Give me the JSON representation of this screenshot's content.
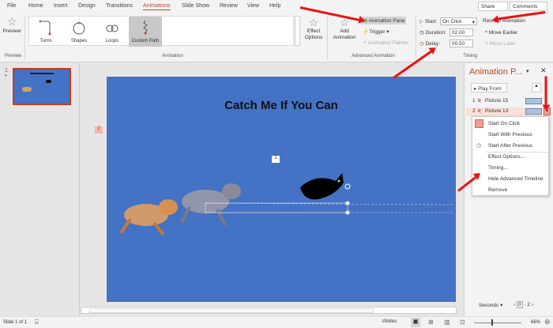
{
  "menu_tabs": [
    "File",
    "Home",
    "Insert",
    "Design",
    "Transitions",
    "Animations",
    "Slide Show",
    "Review",
    "View",
    "Help"
  ],
  "active_tab": "Animations",
  "share_label": "Share",
  "comments_label": "Comments",
  "ribbon": {
    "preview": {
      "label": "Preview",
      "group": "Preview"
    },
    "gallery": [
      {
        "label": "Turns"
      },
      {
        "label": "Shapes"
      },
      {
        "label": "Loops"
      },
      {
        "label": "Custom Path",
        "selected": true
      }
    ],
    "animation_group": "Animation",
    "effect_options": "Effect Options",
    "add_animation": "Add Animation",
    "animation_pane": "Animation Pane",
    "trigger": "Trigger",
    "animation_painter": "Animation Painter",
    "advanced_group": "Advanced Animation",
    "start_label": "Start:",
    "start_value": "On Click",
    "duration_label": "Duration:",
    "duration_value": "02.00",
    "delay_label": "Delay:",
    "delay_value": "00.50",
    "timing_group": "Timing",
    "reorder": "Reorder Animation",
    "move_earlier": "Move Earlier",
    "move_later": "Move Later"
  },
  "thumbnail": {
    "number": "1",
    "star": "*"
  },
  "slide": {
    "title": "Catch Me If You Can",
    "tag_left": "2",
    "tag_center": "1"
  },
  "pane": {
    "title": "Animation P...",
    "play_from": "Play From",
    "items": [
      {
        "num": "1",
        "name": "Picture 15"
      },
      {
        "num": "2",
        "name": "Picture 13",
        "selected": true
      }
    ],
    "context_menu": [
      "Start On Click",
      "Start With Previous",
      "Start After Previous",
      "Effect Options...",
      "Timing...",
      "Hide Advanced Timeline",
      "Remove"
    ],
    "seconds_label": "Seconds",
    "timeline_start": "0",
    "timeline_end": "2"
  },
  "status": {
    "slide": "Slide 1 of 1",
    "notes": "Notes",
    "zoom": "66%"
  },
  "colors": {
    "accent": "#b7472a",
    "slide_bg": "#4472c4",
    "arrow": "#e11111"
  }
}
